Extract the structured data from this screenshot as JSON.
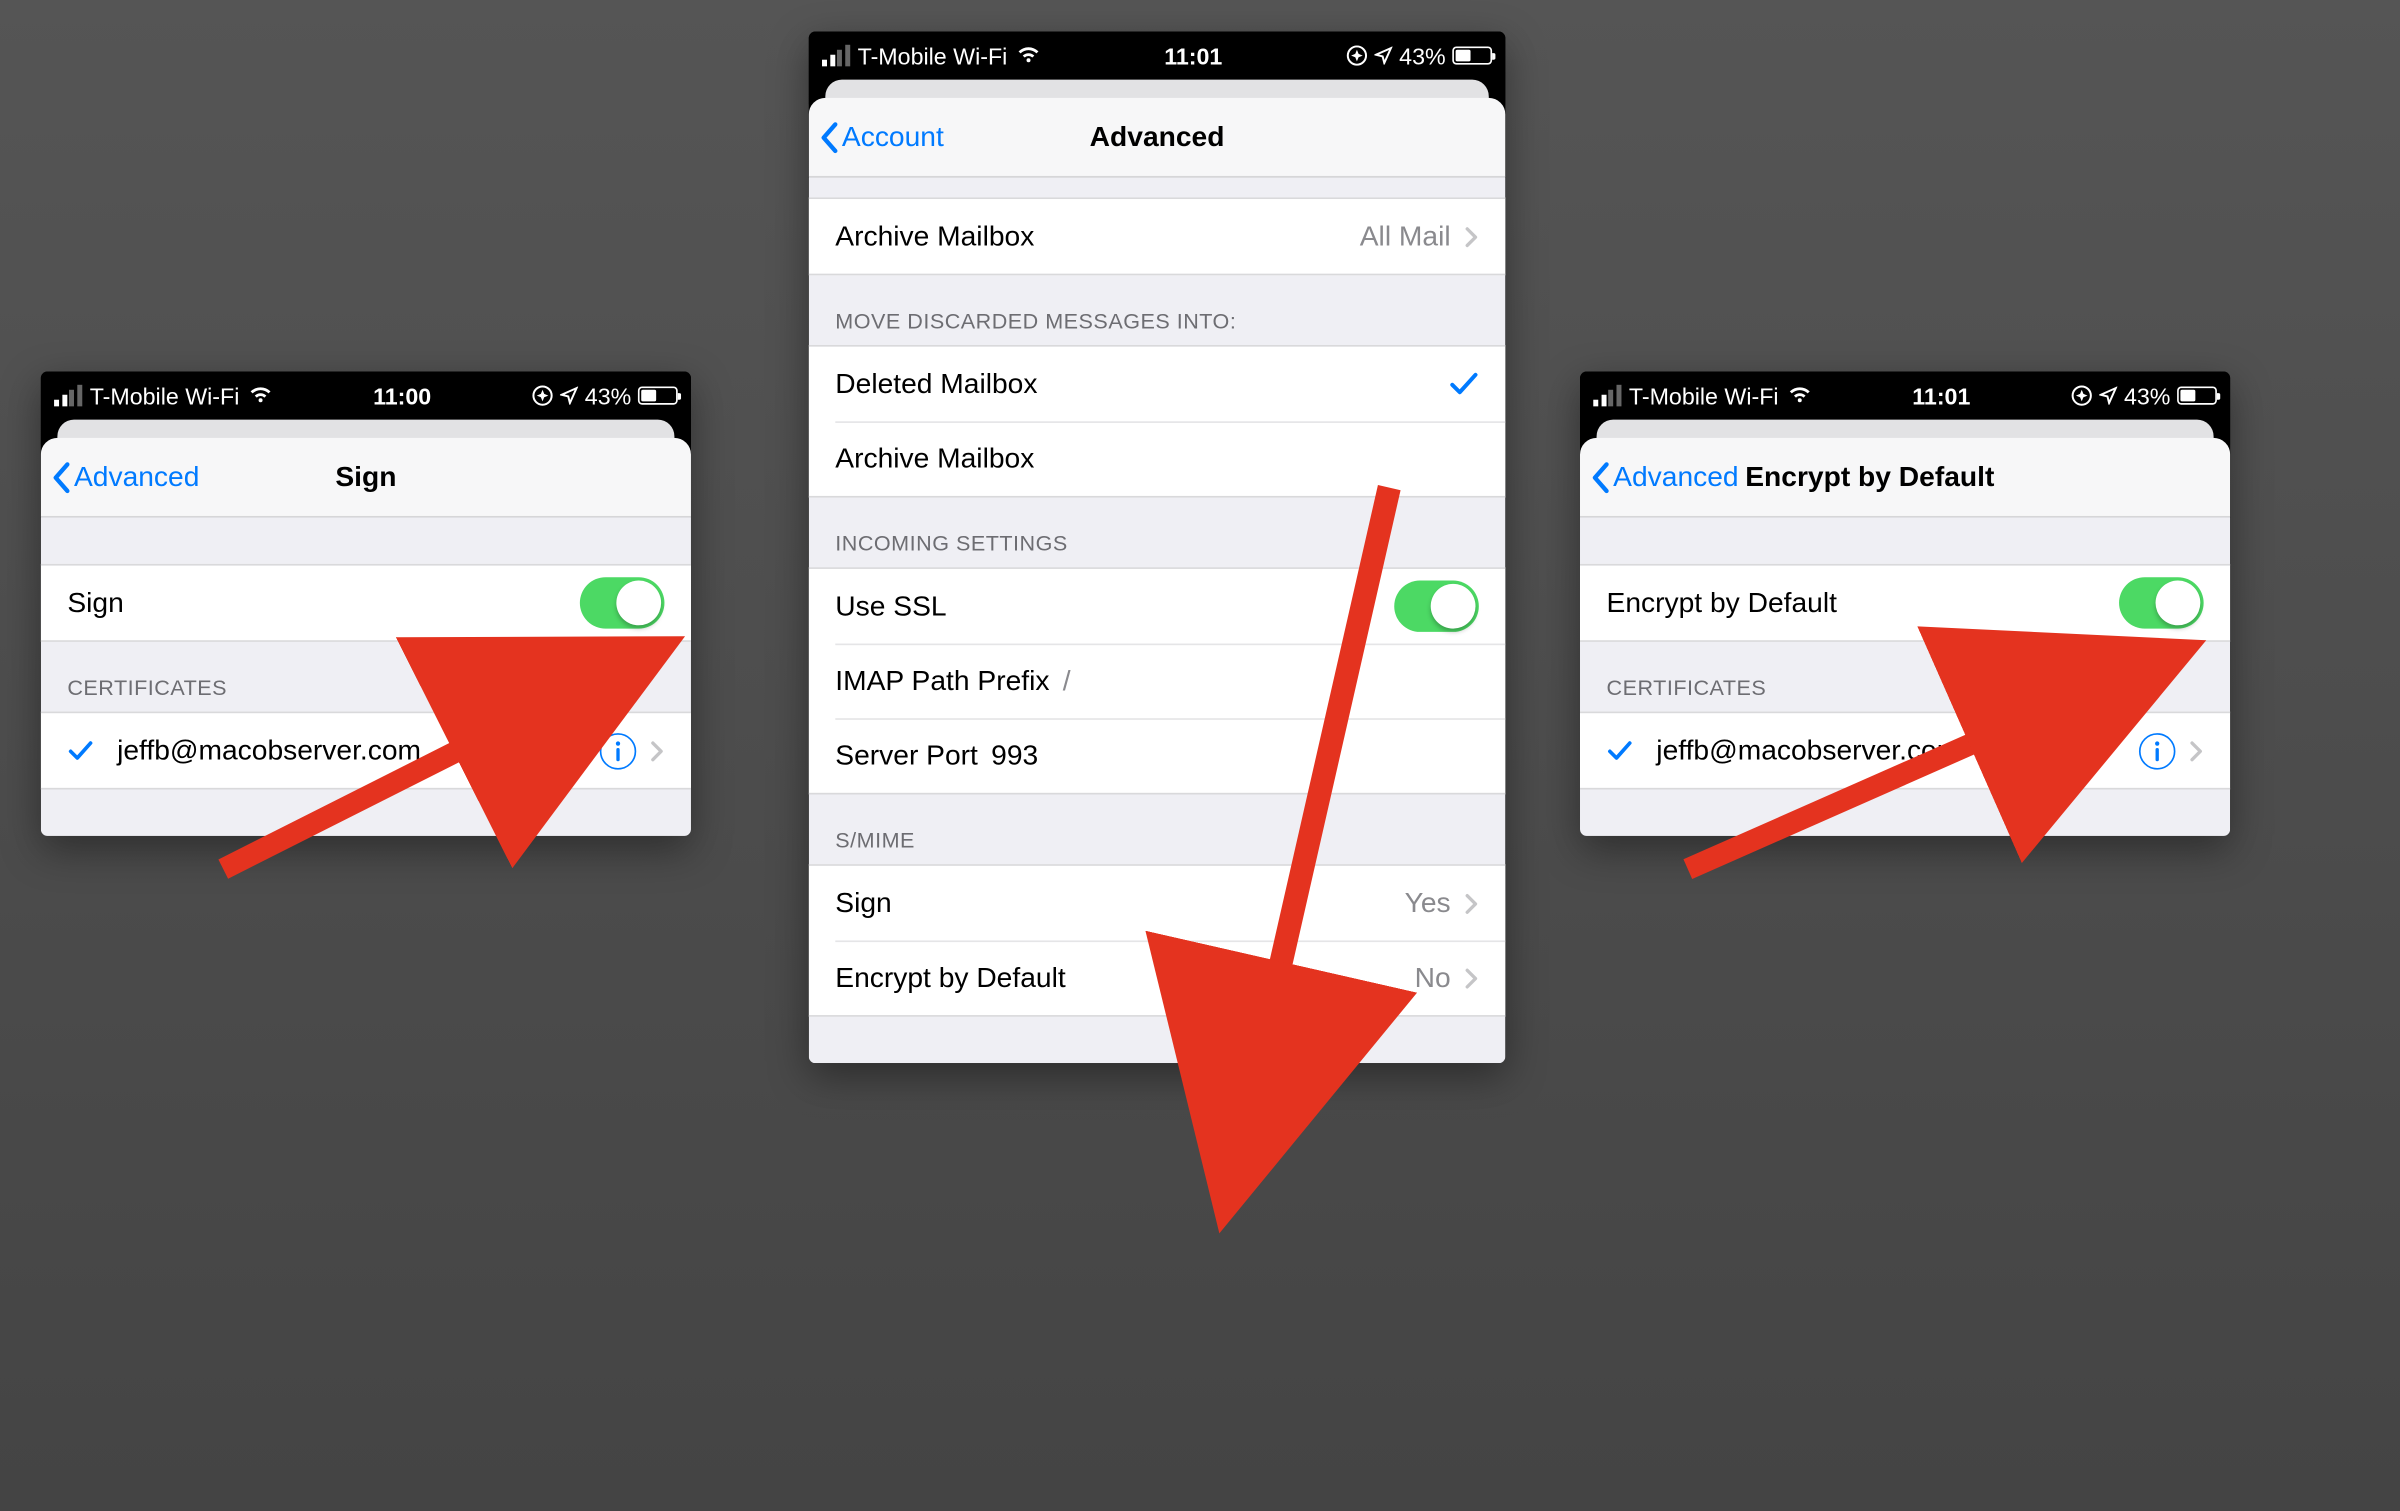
{
  "statusbar": {
    "carrier": "T-Mobile Wi-Fi",
    "time_a": "11:00",
    "time_b": "11:01",
    "battery_pct": "43%",
    "battery_fill": 43
  },
  "left": {
    "back_label": "Advanced",
    "title": "Sign",
    "sign_row_label": "Sign",
    "cert_header": "CERTIFICATES",
    "cert_email": "jeffb@macobserver.com"
  },
  "center": {
    "back_label": "Account",
    "title": "Advanced",
    "archive_label": "Archive Mailbox",
    "archive_value": "All Mail",
    "discard_header": "MOVE DISCARDED MESSAGES INTO:",
    "deleted_label": "Deleted Mailbox",
    "archive2_label": "Archive Mailbox",
    "incoming_header": "INCOMING SETTINGS",
    "ssl_label": "Use SSL",
    "imap_prefix_label": "IMAP Path Prefix",
    "imap_prefix_value": "/",
    "port_label": "Server Port",
    "port_value": "993",
    "smime_header": "S/MIME",
    "sign_label": "Sign",
    "sign_value": "Yes",
    "encrypt_label": "Encrypt by Default",
    "encrypt_value": "No"
  },
  "right": {
    "back_label": "Advanced",
    "title": "Encrypt by Default",
    "toggle_label": "Encrypt by Default",
    "cert_header": "CERTIFICATES",
    "cert_email": "jeffb@macobserver.com"
  }
}
